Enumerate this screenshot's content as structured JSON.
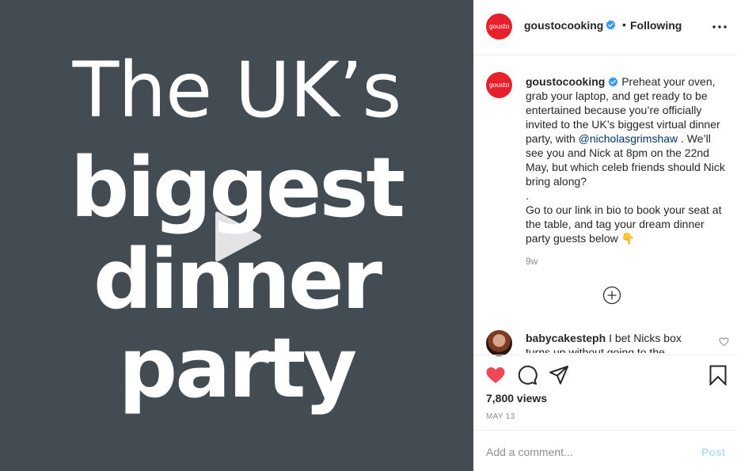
{
  "media": {
    "lines": [
      "The UK’s",
      "biggest",
      "dinner",
      "party"
    ],
    "background": "#434b53",
    "play_icon": "play-icon"
  },
  "header": {
    "avatar_text": "gousto",
    "username": "goustocooking",
    "dot": "•",
    "follow_status": "Following",
    "more_icon": "more-horizontal-icon"
  },
  "caption": {
    "avatar_text": "gousto",
    "username": "goustocooking",
    "text_part1": "Preheat your oven, grab your laptop, and get ready to be entertained because you’re officially invited to the UK’s biggest virtual dinner party, with",
    "mention": "@nicholasgrimshaw",
    "text_part2": ". We’ll see you and Nick at 8pm on the 22nd May, but which celeb friends should Nick bring along?",
    "separator": ".",
    "text_part3": "Go to our link in bio to book your seat at the table, and tag your dream dinner party guests below",
    "emoji": "👇",
    "time_ago": "9w"
  },
  "comments": [
    {
      "username": "babycakesteph",
      "text": "I bet Nicks box turns up without going to the"
    }
  ],
  "actions": {
    "views": "7,800 views",
    "date": "MAY 13",
    "brand_accent": "#ed4956"
  },
  "add_comment": {
    "placeholder": "Add a comment...",
    "post_label": "Post"
  }
}
